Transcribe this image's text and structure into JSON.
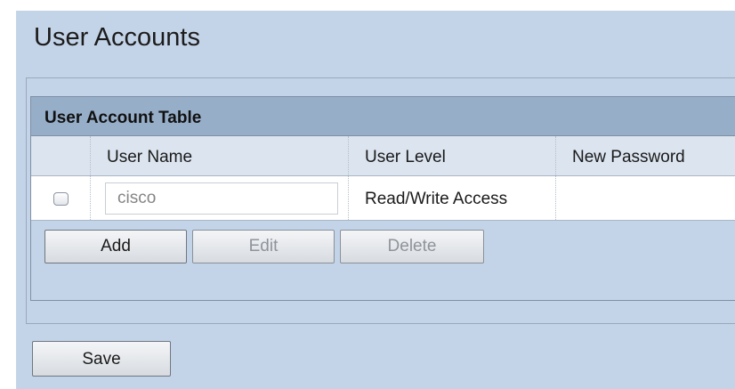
{
  "page": {
    "title": "User Accounts"
  },
  "table": {
    "caption": "User Account Table",
    "columns": [
      "",
      "User Name",
      "User Level",
      "New Password"
    ],
    "rows": [
      {
        "checked": false,
        "user_name": "cisco",
        "user_level": "Read/Write Access",
        "new_password": ""
      }
    ],
    "buttons": {
      "add": "Add",
      "edit": "Edit",
      "delete": "Delete"
    }
  },
  "footer": {
    "save_label": "Save"
  }
}
